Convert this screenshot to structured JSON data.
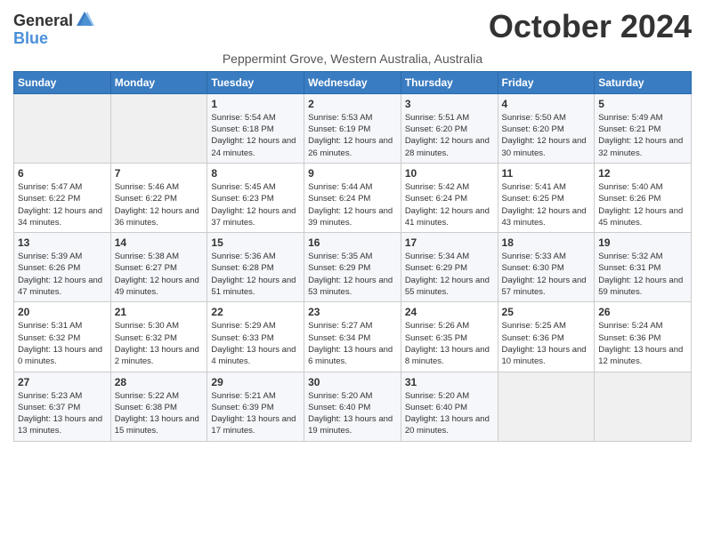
{
  "header": {
    "logo_general": "General",
    "logo_blue": "Blue",
    "month_title": "October 2024",
    "subtitle": "Peppermint Grove, Western Australia, Australia"
  },
  "days_of_week": [
    "Sunday",
    "Monday",
    "Tuesday",
    "Wednesday",
    "Thursday",
    "Friday",
    "Saturday"
  ],
  "weeks": [
    [
      {
        "day": "",
        "info": ""
      },
      {
        "day": "",
        "info": ""
      },
      {
        "day": "1",
        "info": "Sunrise: 5:54 AM\nSunset: 6:18 PM\nDaylight: 12 hours and 24 minutes."
      },
      {
        "day": "2",
        "info": "Sunrise: 5:53 AM\nSunset: 6:19 PM\nDaylight: 12 hours and 26 minutes."
      },
      {
        "day": "3",
        "info": "Sunrise: 5:51 AM\nSunset: 6:20 PM\nDaylight: 12 hours and 28 minutes."
      },
      {
        "day": "4",
        "info": "Sunrise: 5:50 AM\nSunset: 6:20 PM\nDaylight: 12 hours and 30 minutes."
      },
      {
        "day": "5",
        "info": "Sunrise: 5:49 AM\nSunset: 6:21 PM\nDaylight: 12 hours and 32 minutes."
      }
    ],
    [
      {
        "day": "6",
        "info": "Sunrise: 5:47 AM\nSunset: 6:22 PM\nDaylight: 12 hours and 34 minutes."
      },
      {
        "day": "7",
        "info": "Sunrise: 5:46 AM\nSunset: 6:22 PM\nDaylight: 12 hours and 36 minutes."
      },
      {
        "day": "8",
        "info": "Sunrise: 5:45 AM\nSunset: 6:23 PM\nDaylight: 12 hours and 37 minutes."
      },
      {
        "day": "9",
        "info": "Sunrise: 5:44 AM\nSunset: 6:24 PM\nDaylight: 12 hours and 39 minutes."
      },
      {
        "day": "10",
        "info": "Sunrise: 5:42 AM\nSunset: 6:24 PM\nDaylight: 12 hours and 41 minutes."
      },
      {
        "day": "11",
        "info": "Sunrise: 5:41 AM\nSunset: 6:25 PM\nDaylight: 12 hours and 43 minutes."
      },
      {
        "day": "12",
        "info": "Sunrise: 5:40 AM\nSunset: 6:26 PM\nDaylight: 12 hours and 45 minutes."
      }
    ],
    [
      {
        "day": "13",
        "info": "Sunrise: 5:39 AM\nSunset: 6:26 PM\nDaylight: 12 hours and 47 minutes."
      },
      {
        "day": "14",
        "info": "Sunrise: 5:38 AM\nSunset: 6:27 PM\nDaylight: 12 hours and 49 minutes."
      },
      {
        "day": "15",
        "info": "Sunrise: 5:36 AM\nSunset: 6:28 PM\nDaylight: 12 hours and 51 minutes."
      },
      {
        "day": "16",
        "info": "Sunrise: 5:35 AM\nSunset: 6:29 PM\nDaylight: 12 hours and 53 minutes."
      },
      {
        "day": "17",
        "info": "Sunrise: 5:34 AM\nSunset: 6:29 PM\nDaylight: 12 hours and 55 minutes."
      },
      {
        "day": "18",
        "info": "Sunrise: 5:33 AM\nSunset: 6:30 PM\nDaylight: 12 hours and 57 minutes."
      },
      {
        "day": "19",
        "info": "Sunrise: 5:32 AM\nSunset: 6:31 PM\nDaylight: 12 hours and 59 minutes."
      }
    ],
    [
      {
        "day": "20",
        "info": "Sunrise: 5:31 AM\nSunset: 6:32 PM\nDaylight: 13 hours and 0 minutes."
      },
      {
        "day": "21",
        "info": "Sunrise: 5:30 AM\nSunset: 6:32 PM\nDaylight: 13 hours and 2 minutes."
      },
      {
        "day": "22",
        "info": "Sunrise: 5:29 AM\nSunset: 6:33 PM\nDaylight: 13 hours and 4 minutes."
      },
      {
        "day": "23",
        "info": "Sunrise: 5:27 AM\nSunset: 6:34 PM\nDaylight: 13 hours and 6 minutes."
      },
      {
        "day": "24",
        "info": "Sunrise: 5:26 AM\nSunset: 6:35 PM\nDaylight: 13 hours and 8 minutes."
      },
      {
        "day": "25",
        "info": "Sunrise: 5:25 AM\nSunset: 6:36 PM\nDaylight: 13 hours and 10 minutes."
      },
      {
        "day": "26",
        "info": "Sunrise: 5:24 AM\nSunset: 6:36 PM\nDaylight: 13 hours and 12 minutes."
      }
    ],
    [
      {
        "day": "27",
        "info": "Sunrise: 5:23 AM\nSunset: 6:37 PM\nDaylight: 13 hours and 13 minutes."
      },
      {
        "day": "28",
        "info": "Sunrise: 5:22 AM\nSunset: 6:38 PM\nDaylight: 13 hours and 15 minutes."
      },
      {
        "day": "29",
        "info": "Sunrise: 5:21 AM\nSunset: 6:39 PM\nDaylight: 13 hours and 17 minutes."
      },
      {
        "day": "30",
        "info": "Sunrise: 5:20 AM\nSunset: 6:40 PM\nDaylight: 13 hours and 19 minutes."
      },
      {
        "day": "31",
        "info": "Sunrise: 5:20 AM\nSunset: 6:40 PM\nDaylight: 13 hours and 20 minutes."
      },
      {
        "day": "",
        "info": ""
      },
      {
        "day": "",
        "info": ""
      }
    ]
  ]
}
